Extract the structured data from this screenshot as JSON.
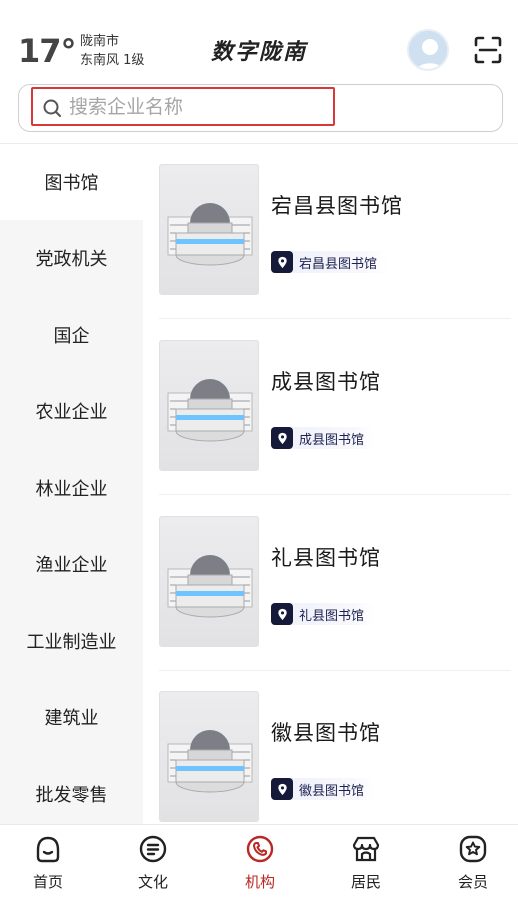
{
  "header": {
    "temperature": "17°",
    "city": "陇南市",
    "wind": "东南风  1级",
    "app_title": "数字陇南"
  },
  "search": {
    "placeholder": "搜索企业名称"
  },
  "sidebar": {
    "items": [
      {
        "label": "图书馆",
        "active": true
      },
      {
        "label": "党政机关"
      },
      {
        "label": "国企"
      },
      {
        "label": "农业企业"
      },
      {
        "label": "林业企业"
      },
      {
        "label": "渔业企业"
      },
      {
        "label": "工业制造业"
      },
      {
        "label": "建筑业"
      },
      {
        "label": "批发零售"
      }
    ]
  },
  "list": {
    "items": [
      {
        "title": "宕昌县图书馆",
        "tag": "宕昌县图书馆"
      },
      {
        "title": "成县图书馆",
        "tag": "成县图书馆"
      },
      {
        "title": "礼县图书馆",
        "tag": "礼县图书馆"
      },
      {
        "title": "徽县图书馆",
        "tag": "徽县图书馆"
      }
    ]
  },
  "tabbar": {
    "tabs": [
      {
        "label": "首页",
        "icon": "home-smile-icon"
      },
      {
        "label": "文化",
        "icon": "document-lines-icon"
      },
      {
        "label": "机构",
        "icon": "phone-circle-icon",
        "active": true
      },
      {
        "label": "居民",
        "icon": "awning-shop-icon"
      },
      {
        "label": "会员",
        "icon": "star-badge-icon"
      }
    ]
  },
  "colors": {
    "accent": "#b92824",
    "search_highlight": "#d9383a",
    "sidebar_bg": "#f6f6f6",
    "tag_icon_bg": "#141a38"
  }
}
